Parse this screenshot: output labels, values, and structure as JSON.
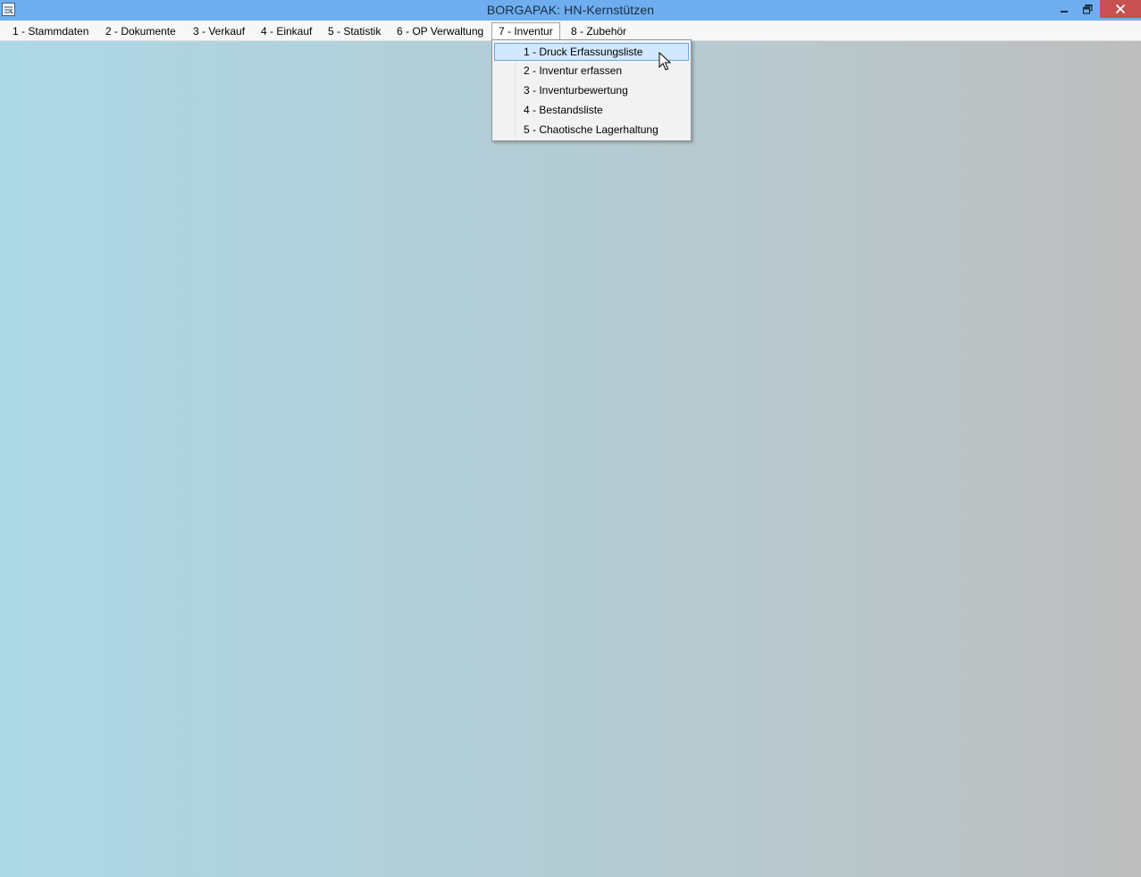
{
  "window": {
    "title": "BORGAPAK: HN-Kernstützen",
    "titlebar_color": "#6eaef0",
    "close_color": "#c75050"
  },
  "menu": {
    "items": [
      {
        "label": "1 - Stammdaten"
      },
      {
        "label": "2 - Dokumente"
      },
      {
        "label": "3 - Verkauf"
      },
      {
        "label": "4 - Einkauf"
      },
      {
        "label": "5 - Statistik"
      },
      {
        "label": "6 - OP Verwaltung"
      },
      {
        "label": "7 - Inventur",
        "open": true
      },
      {
        "label": "8 - Zubehör"
      }
    ]
  },
  "dropdown": {
    "parent": "7 - Inventur",
    "items": [
      {
        "label": "1 - Druck Erfassungsliste",
        "highlighted": true
      },
      {
        "label": "2 - Inventur erfassen"
      },
      {
        "label": "3 - Inventurbewertung"
      },
      {
        "label": "4 - Bestandsliste"
      },
      {
        "label": "5 - Chaotische Lagerhaltung"
      }
    ],
    "highlight_color": "#d1e8ff",
    "highlight_border": "#66a7e8"
  },
  "icons": {
    "app": "app-icon",
    "minimize": "minimize-icon",
    "maximize": "restore-icon",
    "close": "close-icon",
    "cursor": "mouse-pointer-icon"
  }
}
